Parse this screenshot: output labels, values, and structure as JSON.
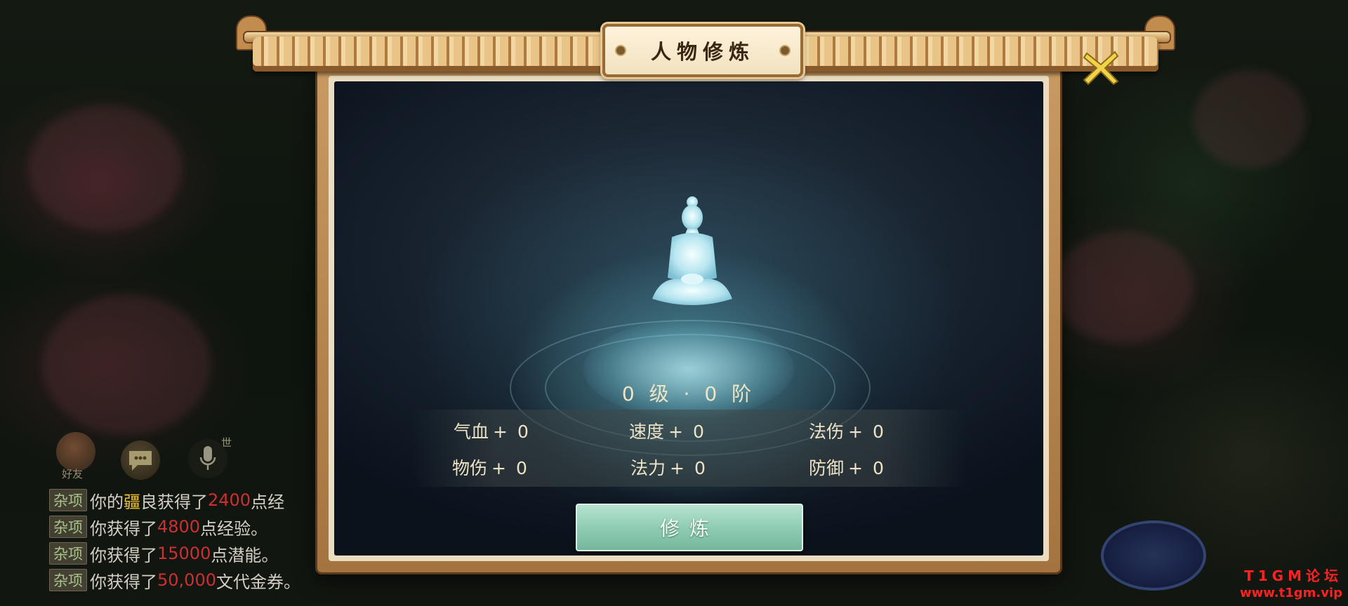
{
  "dialog": {
    "title": "人物修炼",
    "level_text": "0 级 · 0 阶",
    "stats": [
      {
        "label": "气血",
        "value": "0"
      },
      {
        "label": "速度",
        "value": "0"
      },
      {
        "label": "法伤",
        "value": "0"
      },
      {
        "label": "物伤",
        "value": "0"
      },
      {
        "label": "法力",
        "value": "0"
      },
      {
        "label": "防御",
        "value": "0"
      }
    ],
    "plus_sign": "+",
    "cultivate_button": "修炼"
  },
  "hud": {
    "friend_label": "好友",
    "mic_tag": "世"
  },
  "chat": [
    {
      "tag": "杂项",
      "parts": [
        {
          "t": "你的",
          "c": ""
        },
        {
          "t": "疆",
          "c": "gold"
        },
        {
          "t": "良获得了",
          "c": ""
        },
        {
          "t": "2400",
          "c": "red"
        },
        {
          "t": "点经",
          "c": ""
        }
      ]
    },
    {
      "tag": "杂项",
      "parts": [
        {
          "t": "你获得了",
          "c": ""
        },
        {
          "t": "4800",
          "c": "red"
        },
        {
          "t": "点经验。",
          "c": ""
        }
      ]
    },
    {
      "tag": "杂项",
      "parts": [
        {
          "t": "你获得了",
          "c": ""
        },
        {
          "t": "15000",
          "c": "red"
        },
        {
          "t": "点潜能。",
          "c": ""
        }
      ]
    },
    {
      "tag": "杂项",
      "parts": [
        {
          "t": "你获得了",
          "c": ""
        },
        {
          "t": "50,000",
          "c": "red"
        },
        {
          "t": "文代金券。",
          "c": ""
        }
      ]
    }
  ],
  "watermark": {
    "line1": "T1GM论坛",
    "line2": "www.t1gm.vip"
  },
  "colors": {
    "frame": "#b8844a",
    "button": "#8fcdb3",
    "close": "#f0d34a",
    "chat_value": "#cc3030"
  }
}
